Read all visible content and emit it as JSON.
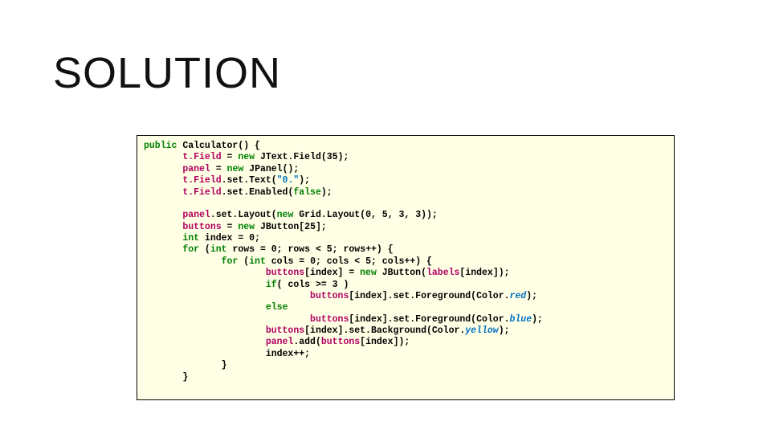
{
  "title": "SOLUTION",
  "code": {
    "tokens": {
      "public": "public",
      "new": "new",
      "int": "int",
      "for": "for",
      "if": "if",
      "else": "else",
      "false": "false",
      "red": "red",
      "blue": "blue",
      "yellow": "yellow",
      "str0": "\"0.\"",
      "tfield": "t.Field",
      "panel": "panel",
      "buttons": "buttons",
      "labels": "labels"
    },
    "plain": {
      "l1a": " Calculator() {",
      "l2a": " = ",
      "l2b": " JText.Field(35);",
      "l3a": " = ",
      "l3b": " JPanel();",
      "l4a": ".set.Text(",
      "l4b": ");",
      "l5a": ".set.Enabled(",
      "l5b": ");",
      "l7a": ".set.Layout(",
      "l7b": " Grid.Layout(0, 5, 3, 3));",
      "l8a": " = ",
      "l8b": " JButton[25];",
      "l9a": " index = 0;",
      "l10a": " (",
      "l10b": " rows = 0; rows < 5; rows++) {",
      "l11a": " (",
      "l11b": " cols = 0; cols < 5; cols++) {",
      "l12a": "[index] = ",
      "l12b": " JButton(",
      "l12c": "[index]);",
      "l13a": "( cols >= 3 )",
      "l14a": "[index].set.Foreground(Color.",
      "l14b": ");",
      "l16a": "[index].set.Foreground(Color.",
      "l16b": ");",
      "l17a": "[index].set.Background(Color.",
      "l17b": ");",
      "l18a": ".add(",
      "l18b": "[index]);",
      "l19a": "index++;",
      "l20a": "}",
      "l21a": "}"
    }
  }
}
